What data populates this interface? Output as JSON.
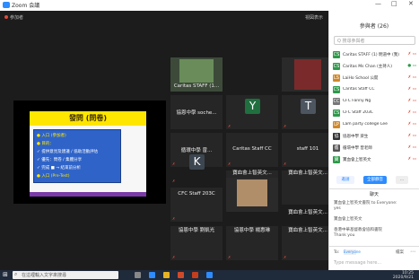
{
  "window": {
    "title": "Zoom 会議",
    "minimize": "—",
    "maximize": "□",
    "close": "✕"
  },
  "meeting": {
    "top_left": "参加者",
    "top_right": "視図表示",
    "slide": {
      "title": "發問 (問卷)",
      "lines": [
        "● 入口 (參加者)",
        "● 目的：",
        "  ✓ 提供意見及建議 / 協助活動評估",
        "  ✓ 優先：問卷 / 集體分享",
        "  ✓ 完成 ■    → 結束前分析",
        "● 入口 (Pre-Test)"
      ]
    },
    "tiles": [
      {
        "name": "Caritas STAFF (1...",
        "kind": "photo"
      },
      {
        "name": "",
        "kind": "photo"
      },
      {
        "name": "協恩中學 soche...",
        "kind": "blank"
      },
      {
        "name": "Y",
        "kind": "letter",
        "color": "#1f6f3f"
      },
      {
        "name": "T",
        "kind": "letter",
        "color": "#4c5560"
      },
      {
        "name": "循環中學 曾...",
        "kind": "blank"
      },
      {
        "name": "Caritas Staff CC",
        "kind": "blank"
      },
      {
        "name": "staff 101",
        "kind": "blank"
      },
      {
        "name": "K",
        "kind": "letter",
        "color": "#3c4650"
      },
      {
        "name": "寶血會上智英文...",
        "kind": "blank"
      },
      {
        "name": "寶血會上智英文...",
        "kind": "blank"
      },
      {
        "name": "CFC Staff 203C",
        "kind": "blank"
      },
      {
        "name": "",
        "kind": "photo"
      },
      {
        "name": "寶血會上智英文...",
        "kind": "blank"
      },
      {
        "name": "協恩中學 劉凱光",
        "kind": "blank"
      },
      {
        "name": "協恩中學 楊惠琳",
        "kind": "blank"
      },
      {
        "name": "寶血會上智英文...",
        "kind": "blank"
      }
    ]
  },
  "panel": {
    "title": "參與者 (26)",
    "search_placeholder": "Q 搜尋參與者",
    "participants": [
      {
        "initials": "CS",
        "color": "#2e9a4a",
        "name": "Caritas STAFF (1) 明道中 (我)"
      },
      {
        "initials": "CS",
        "color": "#2e9a4a",
        "name": "Caritas Ms Chan (主持人)"
      },
      {
        "initials": "LS",
        "color": "#d0882a",
        "name": "LaiHo School 公開"
      },
      {
        "initials": "CS",
        "color": "#2e9a4a",
        "name": "Caritas Staff CC"
      },
      {
        "initials": "CC",
        "color": "#777777",
        "name": "CFC Fanny Ng"
      },
      {
        "initials": "CS",
        "color": "#2e9a4a",
        "name": "CFC Staff 203C"
      },
      {
        "initials": "LP",
        "color": "#d0882a",
        "name": "Lam party college Lee"
      },
      {
        "initials": "協",
        "color": "#333333",
        "name": "協恩中學 梁生"
      },
      {
        "initials": "循",
        "color": "#555555",
        "name": "循環中學 曾老師"
      },
      {
        "initials": "寶",
        "color": "#2e9a4a",
        "name": "寶血會上智英文"
      }
    ],
    "btn_invite": "邀請",
    "btn_mute_all": "全部靜音",
    "btn_more": "...",
    "chat_title": "聊天",
    "chat_lines": [
      "寶血會上智英文書院 to Everyone:",
      "yes",
      "寶血會上智英文",
      "香港中華基督教會協和書院",
      "Thank you"
    ],
    "chat_to_label": "To:",
    "chat_to_value": "Everyone",
    "chat_placeholder": "Type message here...",
    "chat_file": "檔案"
  },
  "taskbar": {
    "start": "⊞",
    "search_placeholder": "在這裡輸入文字來搜尋",
    "time": "10:25",
    "date": "2020/9/21"
  }
}
